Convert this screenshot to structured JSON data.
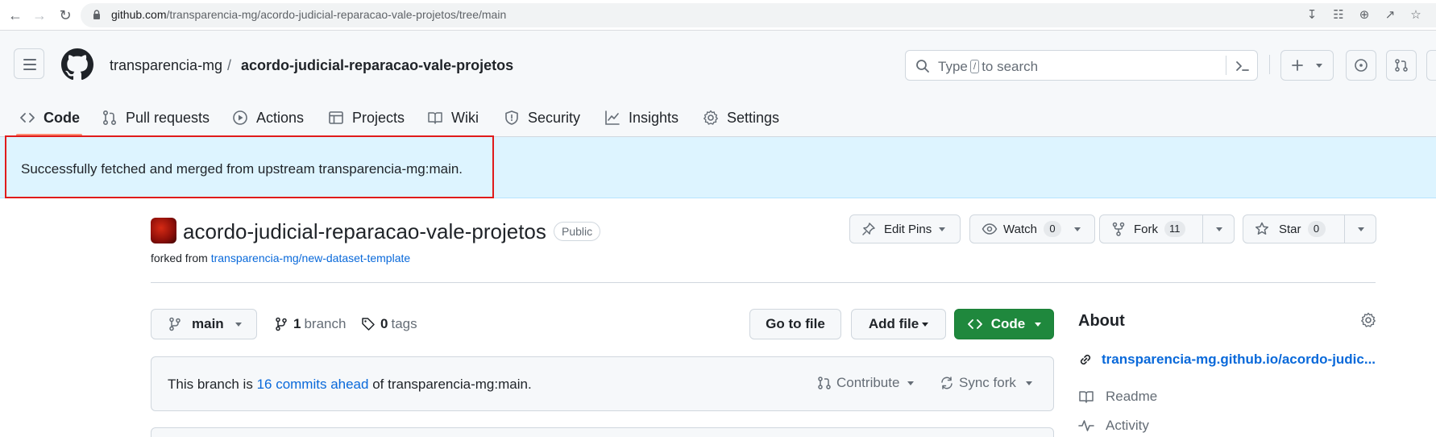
{
  "browser": {
    "url_host": "github.com",
    "url_path": "/transparencia-mg/acordo-judicial-reparacao-vale-projetos/tree/main"
  },
  "header": {
    "owner": "transparencia-mg",
    "separator": "/",
    "repo": "acordo-judicial-reparacao-vale-projetos",
    "search_prefix": "Type",
    "search_key": "/",
    "search_suffix": "to search"
  },
  "repo_nav": {
    "items": [
      {
        "label": "Code",
        "icon": "code-icon",
        "selected": true
      },
      {
        "label": "Pull requests",
        "icon": "pull-request-icon"
      },
      {
        "label": "Actions",
        "icon": "play-icon"
      },
      {
        "label": "Projects",
        "icon": "table-icon"
      },
      {
        "label": "Wiki",
        "icon": "book-icon"
      },
      {
        "label": "Security",
        "icon": "shield-icon"
      },
      {
        "label": "Insights",
        "icon": "graph-icon"
      },
      {
        "label": "Settings",
        "icon": "gear-icon"
      }
    ]
  },
  "flash": {
    "message": "Successfully fetched and merged from upstream transparencia-mg:main."
  },
  "repo": {
    "title": "acordo-judicial-reparacao-vale-projetos",
    "visibility": "Public",
    "forked_prefix": "forked from",
    "forked_source": "transparencia-mg/new-dataset-template",
    "edit_pins": "Edit Pins",
    "watch": "Watch",
    "watch_count": "0",
    "fork": "Fork",
    "fork_count": "11",
    "star": "Star",
    "star_count": "0"
  },
  "branch_bar": {
    "branch": "main",
    "branch_count": "1",
    "branch_label": "branch",
    "tag_count": "0",
    "tag_label": "tags",
    "go_to_file": "Go to file",
    "add_file": "Add file",
    "code": "Code"
  },
  "fork_status": {
    "prefix": "This branch is",
    "link": "16 commits ahead",
    "suffix": "of transparencia-mg:main.",
    "contribute": "Contribute",
    "sync_fork": "Sync fork"
  },
  "about": {
    "title": "About",
    "website": "transparencia-mg.github.io/acordo-judic...",
    "readme": "Readme",
    "activity": "Activity"
  },
  "colors": {
    "flash_bg": "#ddf4ff",
    "highlight_outline": "#e01b1b",
    "link": "#0969da",
    "primary_button": "#1f883d",
    "nav_underline": "#fd8c73"
  }
}
